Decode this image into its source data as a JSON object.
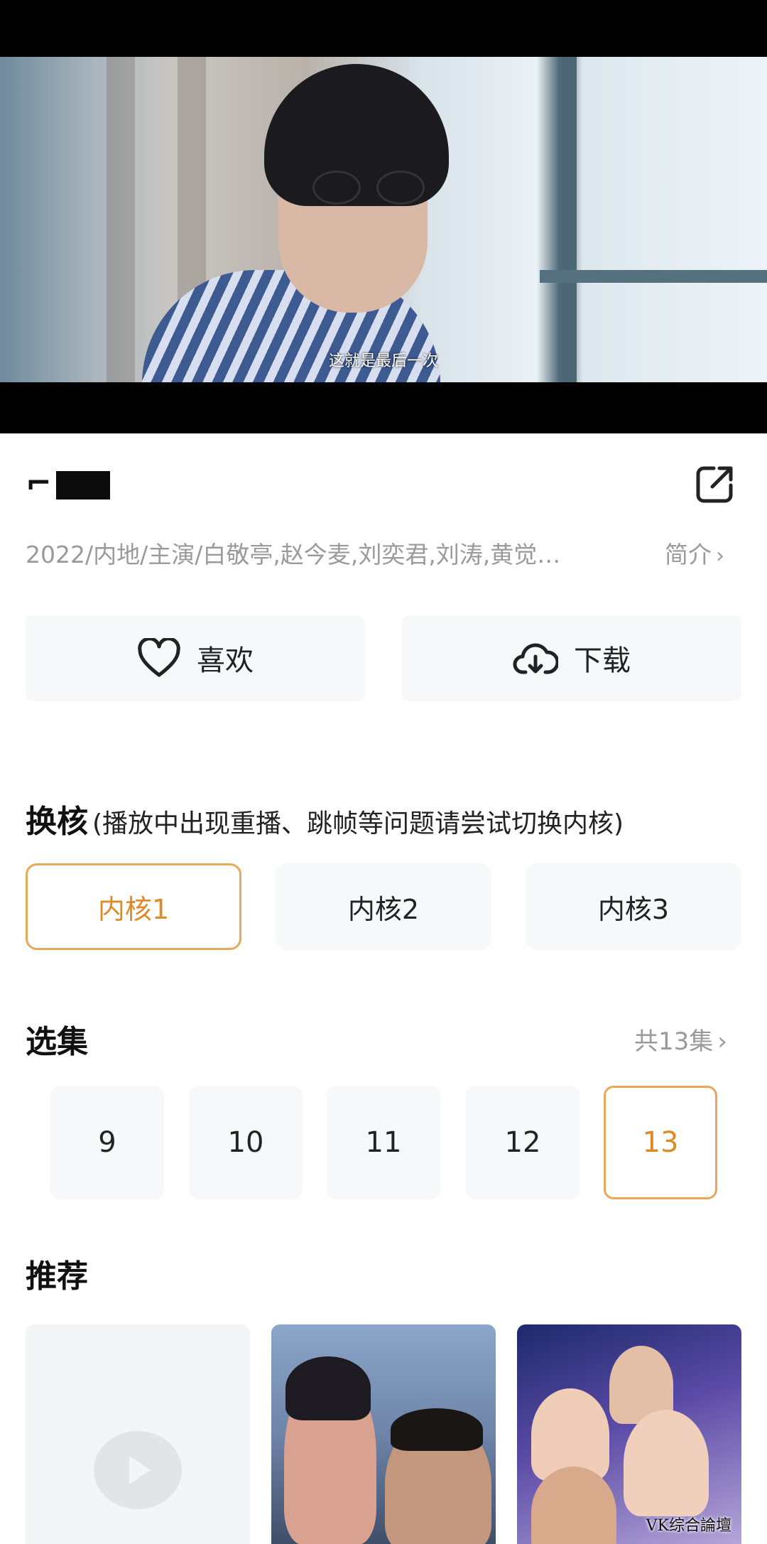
{
  "player": {
    "subtitle": "这就是最后一次"
  },
  "title": {
    "text": "⌐"
  },
  "meta": {
    "text": "2022/内地/主演/白敬亭,赵今麦,刘奕君,刘涛,黄觉…",
    "intro_label": "简介",
    "chevron": "›"
  },
  "actions": {
    "like_label": "喜欢",
    "download_label": "下载"
  },
  "core": {
    "title": "换核",
    "hint": "(播放中出现重播、跳帧等问题请尝试切换内核)",
    "options": [
      "内核1",
      "内核2",
      "内核3"
    ],
    "selected_index": 0
  },
  "episodes": {
    "title": "选集",
    "count_label": "共13集",
    "chevron": "›",
    "items": [
      "9",
      "10",
      "11",
      "12",
      "13"
    ],
    "selected": "13"
  },
  "recommend": {
    "title": "推荐"
  },
  "watermark": "VK综合論壇",
  "colors": {
    "accent": "#e7a857",
    "accent_text": "#e08a26",
    "muted": "#9a9a9a"
  },
  "icons": {
    "share": "share-external-icon",
    "like": "heart-outline-icon",
    "download": "cloud-download-icon"
  }
}
